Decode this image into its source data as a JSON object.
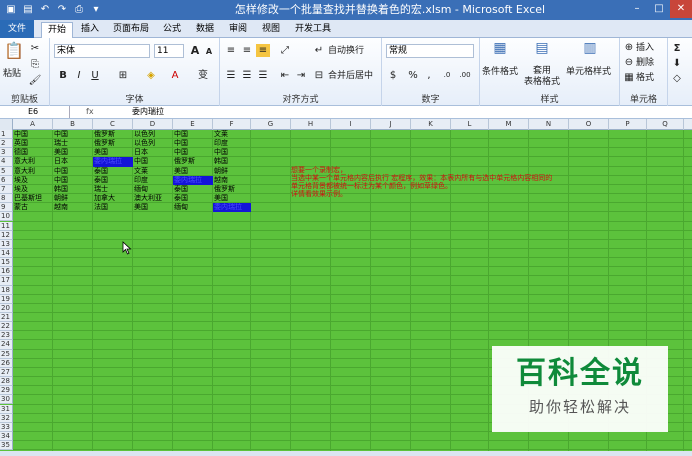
{
  "window": {
    "title": "怎样修改一个批量查找并替换着色的宏.xlsm - Microsoft Excel",
    "min": "–",
    "max": "□",
    "close": "✕"
  },
  "tabs": [
    "文件",
    "开始",
    "插入",
    "页面布局",
    "公式",
    "数据",
    "审阅",
    "视图",
    "开发工具"
  ],
  "ribbon": {
    "clipboard": {
      "paste": "粘贴",
      "label": "剪贴板"
    },
    "font": {
      "name": "宋体",
      "size": "11",
      "bold": "B",
      "italic": "I",
      "underline": "U",
      "grow": "A",
      "shrink": "A",
      "label": "字体"
    },
    "align": {
      "wrap": "自动换行",
      "merge": "合并后居中",
      "label": "对齐方式"
    },
    "number": {
      "format": "常规",
      "label": "数字"
    },
    "styles": {
      "conditional": "条件格式",
      "table": "套用\n表格格式",
      "cell_styles": "单元格样式",
      "label": "样式"
    },
    "cells": {
      "insert": "插入",
      "delete": "删除",
      "format": "格式",
      "label": "单元格"
    },
    "sum": "Σ"
  },
  "formula_bar": {
    "name_box": "E6",
    "fx": "fx",
    "content": "委内瑞拉"
  },
  "grid": {
    "columns": [
      "A",
      "B",
      "C",
      "D",
      "E",
      "F",
      "G",
      "H",
      "I",
      "J",
      "K",
      "L",
      "M",
      "N",
      "O",
      "P",
      "Q"
    ],
    "rows": [
      "1",
      "2",
      "3",
      "4",
      "5",
      "6",
      "7",
      "8",
      "9",
      "10",
      "11",
      "12",
      "13",
      "14",
      "15",
      "16",
      "17",
      "18",
      "19",
      "20",
      "21",
      "22",
      "23",
      "24",
      "25",
      "26",
      "27",
      "28",
      "29",
      "30",
      "31",
      "32",
      "33",
      "34",
      "35"
    ],
    "cells": [
      [
        "中国",
        "中国",
        "俄罗斯",
        "以色列",
        "中国",
        "文莱"
      ],
      [
        "英国",
        "瑞士",
        "俄罗斯",
        "以色列",
        "中国",
        "印度"
      ],
      [
        "德国",
        "美国",
        "美国",
        "日本",
        "中国",
        "中国"
      ],
      [
        "意大利",
        "日本",
        "委内瑞拉",
        "中国",
        "俄罗斯",
        "韩国"
      ],
      [
        "意大利",
        "中国",
        "泰国",
        "文莱",
        "美国",
        "朝鲜"
      ],
      [
        "埃及",
        "中国",
        "泰国",
        "印度",
        "委内瑞拉",
        "越南"
      ],
      [
        "埃及",
        "韩国",
        "瑞士",
        "缅甸",
        "泰国",
        "俄罗斯"
      ],
      [
        "巴基斯坦",
        "朝鲜",
        "加拿大",
        "澳大利亚",
        "泰国",
        "美国"
      ],
      [
        "蒙古",
        "越南",
        "法国",
        "美国",
        "缅甸",
        "委内瑞拉"
      ]
    ],
    "highlight": "#1414d8"
  },
  "note": [
    "想要一个录制宏，",
    "当选中某一个单元格内容后执行  宏程序，效果：本表内所有与选中单元格内容相同的",
    "单元格背景都被统一标注为某个颜色，例如草绿色。",
    "详情看效果示例。"
  ],
  "watermark": {
    "title": "百科全说",
    "subtitle": "助你轻松解决"
  },
  "colors": {
    "sheet_bg": "#5cc23c",
    "note": "#d01010",
    "title_bar": "#3a6fb7"
  }
}
